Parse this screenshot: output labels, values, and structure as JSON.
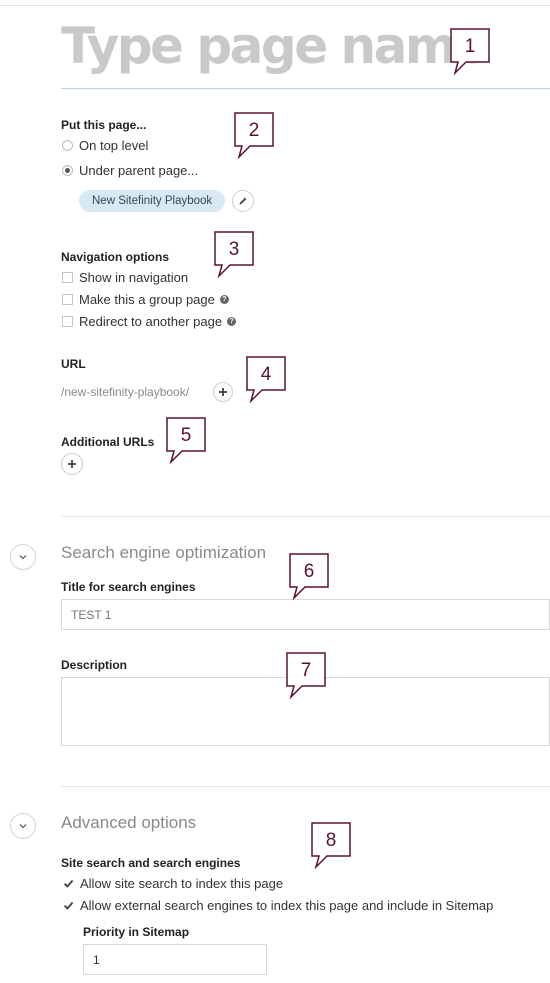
{
  "page_name": {
    "placeholder": "Type page name"
  },
  "placement": {
    "label": "Put this page...",
    "option_top": "On top level",
    "option_parent": "Under parent page...",
    "parent_page": "New Sitefinity Playbook"
  },
  "navigation": {
    "label": "Navigation options",
    "show_in_navigation": "Show in navigation",
    "group_page": "Make this a group page",
    "redirect": "Redirect to another page"
  },
  "url": {
    "label": "URL",
    "value": "/new-sitefinity-playbook/"
  },
  "additional_urls": {
    "label": "Additional URLs"
  },
  "seo": {
    "section_title": "Search engine optimization",
    "title_label": "Title for search engines",
    "title_placeholder": "TEST 1",
    "description_label": "Description"
  },
  "advanced": {
    "section_title": "Advanced options",
    "search_label": "Site search and search engines",
    "allow_site_search": "Allow site search to index this page",
    "allow_external": "Allow external search engines to index this page and include in Sitemap",
    "priority_label": "Priority in Sitemap",
    "priority_value": "1"
  },
  "callouts": [
    "1",
    "2",
    "3",
    "4",
    "5",
    "6",
    "7",
    "8"
  ],
  "colors": {
    "callout": "#5a1232",
    "chip_bg": "#d8e9f3",
    "accent_line": "#b7d3e4"
  }
}
